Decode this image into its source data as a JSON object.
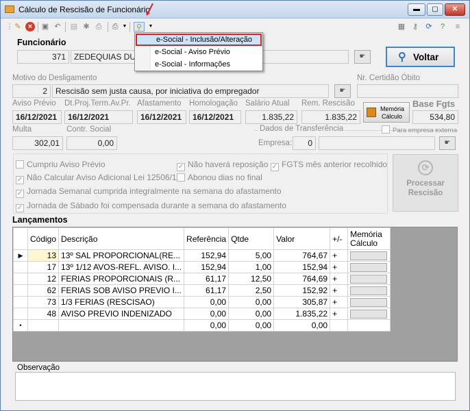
{
  "window": {
    "title": "Cálculo de Rescisão de Funcionário"
  },
  "menu": {
    "items": [
      "e-Social - Inclusão/Alteração",
      "e-Social - Aviso Prévio",
      "e-Social - Informações"
    ]
  },
  "funcionario": {
    "label": "Funcionário",
    "codigo": "371",
    "nome": "ZEDEQUIAS DUT"
  },
  "voltar_label": "Voltar",
  "motivo": {
    "label": "Motivo do Desligamento",
    "codigo": "2",
    "descricao": "Rescisão sem justa causa, por iniciativa do empregador"
  },
  "certidao": {
    "label": "Nr. Certidão Óbito",
    "value": ""
  },
  "datas": {
    "aviso_previo_label": "Aviso Prévio",
    "aviso_previo": "16/12/2021",
    "dt_proj_label": "Dt.Proj.Term.Av.Pr.",
    "dt_proj": "16/12/2021",
    "afastamento_label": "Afastamento",
    "afastamento": "16/12/2021",
    "homologacao_label": "Homologação",
    "homologacao": "16/12/2021",
    "salario_label": "Salário Atual",
    "salario": "1.835,22",
    "rem_label": "Rem. Rescisão",
    "rem": "1.835,22",
    "base_fgts_label": "Base Fgts",
    "base_fgts": "534,80"
  },
  "memoria_label_1": "Memória",
  "memoria_label_2": "Cálculo",
  "multa": {
    "label": "Multa",
    "value": "302,01"
  },
  "contr_social": {
    "label": "Contr. Social",
    "value": "0,00"
  },
  "transferencia": {
    "label": "Dados de Transferência",
    "empresa_label": "Empresa:",
    "empresa": "0",
    "para_empresa_externa": "Para empresa externa"
  },
  "checkboxes": [
    {
      "label": "Cumpriu Aviso Prévio",
      "checked": false
    },
    {
      "label": "Não haverá reposição",
      "checked": true
    },
    {
      "label": "FGTS mês anterior recolhido",
      "checked": true
    },
    {
      "label": "Não Calcular Aviso Adicional Lei 12506/11",
      "checked": true
    },
    {
      "label": "Abonou dias no final",
      "checked": false
    },
    {
      "label": "Jornada Semanal cumprida integralmente na semana do afastamento",
      "checked": true
    },
    {
      "label": "Jornada de Sábado foi compensada durante a semana do afastamento",
      "checked": true
    }
  ],
  "processar": {
    "line1": "Processar",
    "line2": "Rescisão"
  },
  "lancamentos": {
    "title": "Lançamentos",
    "columns": [
      "Código",
      "Descrição",
      "Referência",
      "Qtde",
      "Valor",
      "+/-",
      "Memória Cálculo"
    ],
    "rows": [
      {
        "codigo": "13",
        "descricao": "13º SAL PROPORCIONAL(RE...",
        "referencia": "152,94",
        "qtde": "5,00",
        "valor": "764,67",
        "sinal": "+"
      },
      {
        "codigo": "17",
        "descricao": "13º 1/12 AVOS-REFL. AVISO. I...",
        "referencia": "152,94",
        "qtde": "1,00",
        "valor": "152,94",
        "sinal": "+"
      },
      {
        "codigo": "12",
        "descricao": "FERIAS PROPORCIONAIS (R...",
        "referencia": "61,17",
        "qtde": "12,50",
        "valor": "764,69",
        "sinal": "+"
      },
      {
        "codigo": "62",
        "descricao": "FERIAS SOB AVISO PREVIO I...",
        "referencia": "61,17",
        "qtde": "2,50",
        "valor": "152,92",
        "sinal": "+"
      },
      {
        "codigo": "73",
        "descricao": "1/3 FERIAS (RESCISAO)",
        "referencia": "0,00",
        "qtde": "0,00",
        "valor": "305,87",
        "sinal": "+"
      },
      {
        "codigo": "48",
        "descricao": "AVISO PREVIO INDENIZADO",
        "referencia": "0,00",
        "qtde": "0,00",
        "valor": "1.835,22",
        "sinal": "+"
      }
    ],
    "new_row": {
      "referencia": "0,00",
      "qtde": "0,00",
      "valor": "0,00"
    }
  },
  "observacao": {
    "label": "Observação",
    "value": ""
  }
}
